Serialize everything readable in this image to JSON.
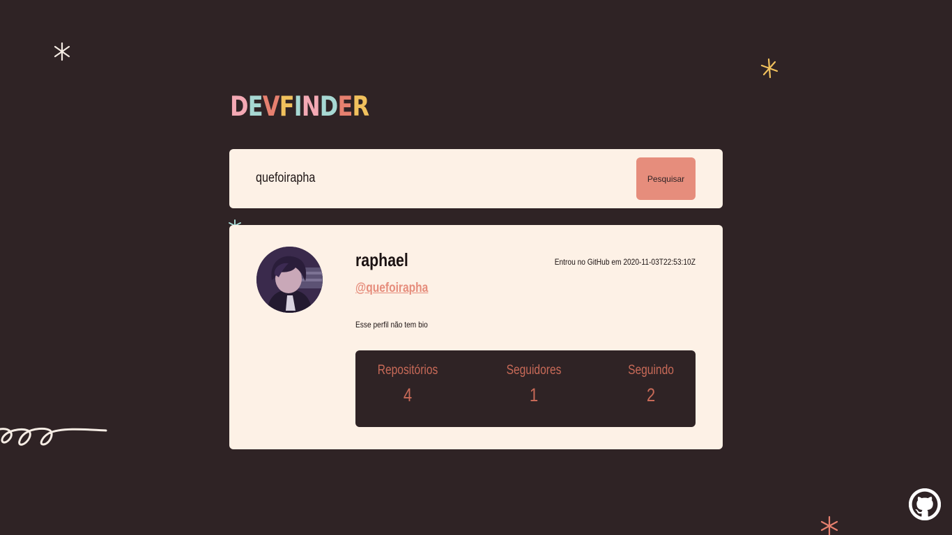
{
  "colors": {
    "background": "#2f2325",
    "card": "#fdf1e6",
    "accent": "#e68d7c",
    "stat_text": "#c86a58",
    "logo_pink": "#f4a9b4",
    "logo_teal": "#a7d8d3",
    "logo_coral": "#e6806f",
    "logo_yellow": "#f1c15d"
  },
  "logo": {
    "letters": [
      "D",
      "E",
      "V",
      "F",
      "I",
      "N",
      "D",
      "E",
      "R"
    ]
  },
  "search": {
    "value": "quefoirapha",
    "button_label": "Pesquisar"
  },
  "profile": {
    "name": "raphael",
    "joined": "Entrou no GitHub em 2020-11-03T22:53:10Z",
    "login": "@quefoirapha",
    "bio": "Esse perfil não tem bio",
    "stats": [
      {
        "label": "Repositórios",
        "value": "4"
      },
      {
        "label": "Seguidores",
        "value": "1"
      },
      {
        "label": "Seguindo",
        "value": "2"
      }
    ]
  },
  "icons": {
    "avatar": "avatar-image",
    "github": "github-icon",
    "decorations": [
      "sparkle-icon",
      "squiggle-decoration"
    ]
  }
}
